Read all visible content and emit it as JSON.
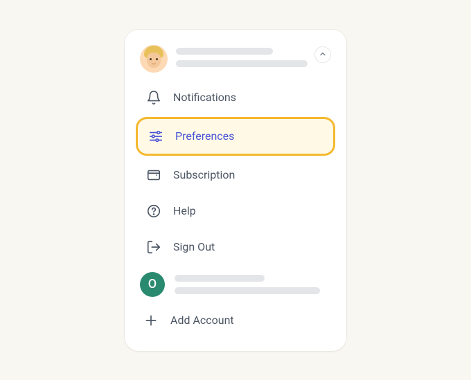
{
  "menu": {
    "items": [
      {
        "label": "Notifications",
        "icon": "bell-icon",
        "highlighted": false
      },
      {
        "label": "Preferences",
        "icon": "sliders-icon",
        "highlighted": true
      },
      {
        "label": "Subscription",
        "icon": "wallet-icon",
        "highlighted": false
      },
      {
        "label": "Help",
        "icon": "help-icon",
        "highlighted": false
      },
      {
        "label": "Sign Out",
        "icon": "signout-icon",
        "highlighted": false
      }
    ]
  },
  "secondary_account": {
    "initial": "O"
  },
  "add_account_label": "Add Account",
  "colors": {
    "highlight_border": "#f5b82e",
    "highlight_bg": "#fff9e6",
    "highlight_text": "#4953d6",
    "secondary_avatar": "#2a8a6f"
  }
}
